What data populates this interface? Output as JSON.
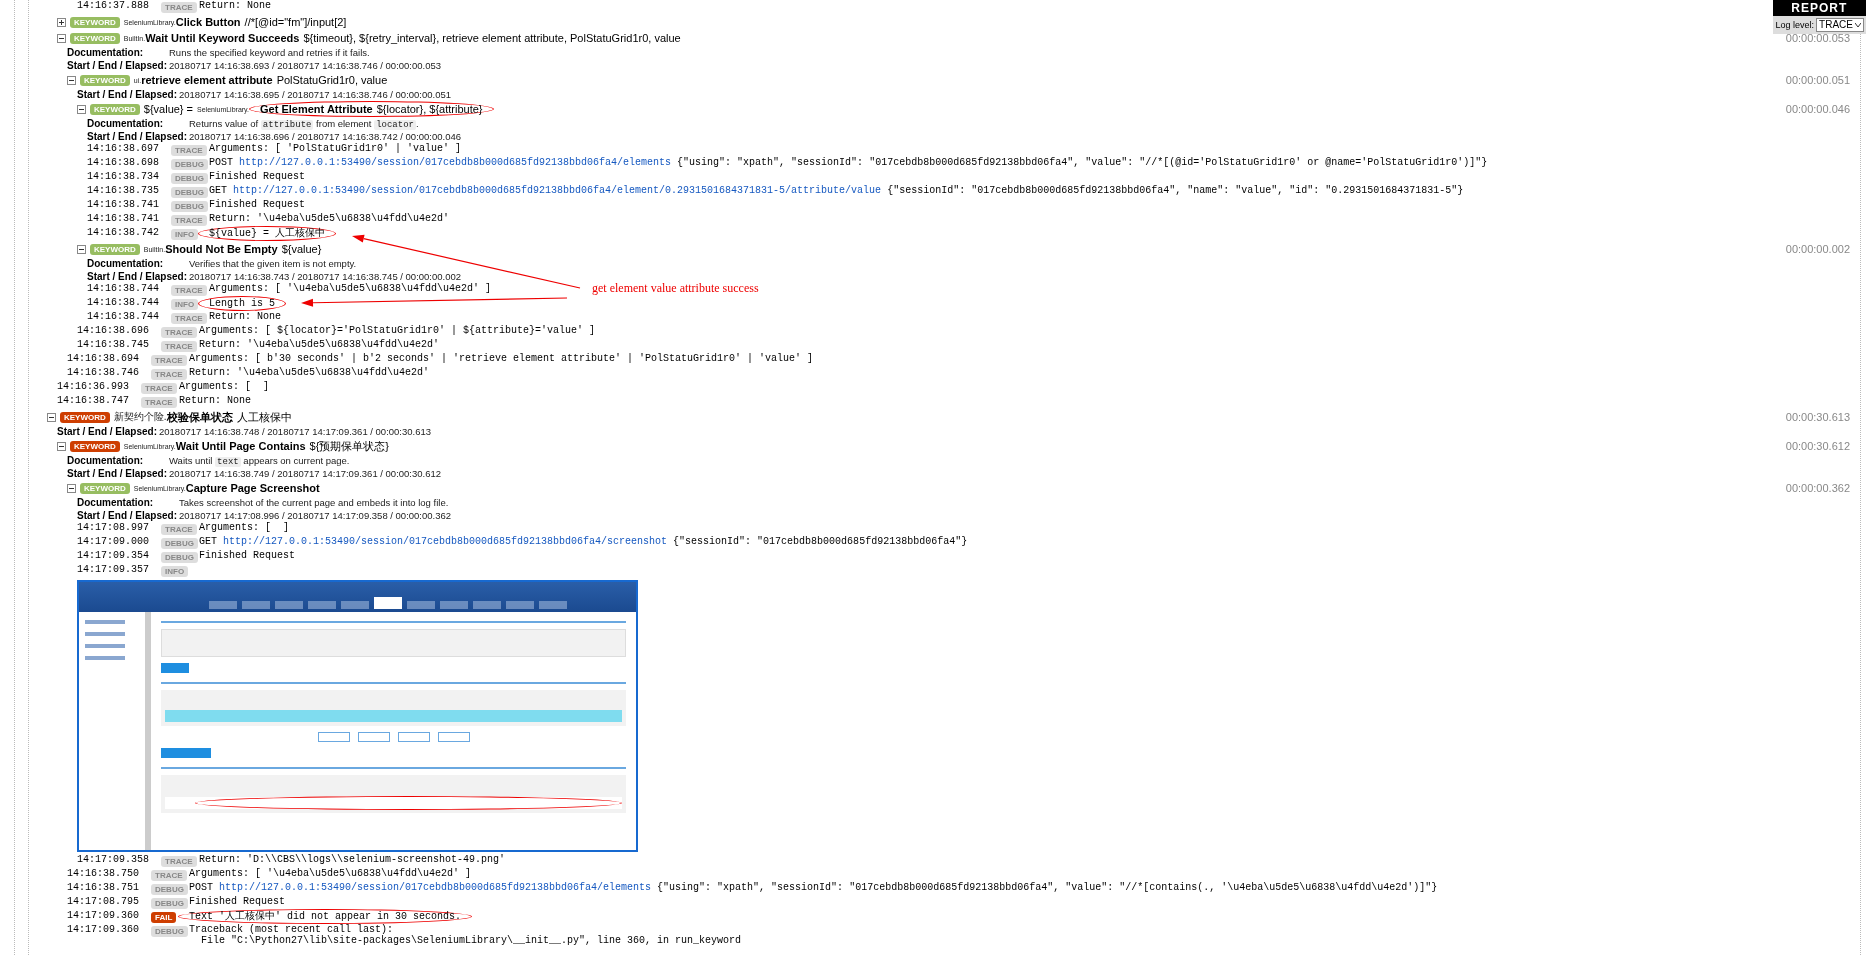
{
  "report_panel": {
    "title": "REPORT",
    "log_level_label": "Log level:",
    "log_level_value": "TRACE"
  },
  "log": [
    {
      "kind": "group",
      "children": [
        {
          "kind": "group",
          "children": [
            {
              "kind": "group",
              "children": [
                {
                  "kind": "message",
                  "time": "14:16:37.888",
                  "log_level": "TRACE",
                  "failed": false,
                  "circled": false,
                  "text": "Return: None"
                }
              ]
            }
          ]
        },
        {
          "kind": "keyword",
          "failed": false,
          "expanded": false,
          "circled": false,
          "badge": "KEYWORD",
          "library": "SeleniumLibrary.",
          "name": "Click Button",
          "args": "//*[@id=\"fm\"]/input[2]"
        },
        {
          "kind": "keyword",
          "failed": false,
          "expanded": true,
          "circled": false,
          "badge": "KEYWORD",
          "library": "BuiltIn.",
          "name": "Wait Until Keyword Succeeds",
          "args": "${timeout}, ${retry_interval}, retrieve element attribute, PolStatuGrid1r0, value",
          "elapsed": "00:00:00.053",
          "doc": {
            "label": "Documentation:",
            "parts": [
              {
                "kind": "text",
                "text": "Runs the specified keyword and retries if it fails."
              }
            ]
          },
          "times": {
            "label": "Start / End / Elapsed:",
            "value": "20180717 14:16:38.693 / 20180717 14:16:38.746 / 00:00:00.053"
          },
          "children": [
            {
              "kind": "keyword",
              "failed": false,
              "expanded": true,
              "circled": false,
              "badge": "KEYWORD",
              "library": "ui.",
              "name": "retrieve element attribute",
              "args": "PolStatuGrid1r0, value",
              "elapsed": "00:00:00.051",
              "times": {
                "label": "Start / End / Elapsed:",
                "value": "20180717 14:16:38.695 / 20180717 14:16:38.746 / 00:00:00.051"
              },
              "children": [
                {
                  "kind": "keyword",
                  "failed": false,
                  "expanded": true,
                  "circled": true,
                  "badge": "KEYWORD",
                  "assign": "${value} =",
                  "library": "SeleniumLibrary.",
                  "name": "Get Element Attribute",
                  "args": "${locator}, ${attribute}",
                  "elapsed": "00:00:00.046",
                  "doc": {
                    "label": "Documentation:",
                    "parts": [
                      {
                        "kind": "text",
                        "text": "Returns value of "
                      },
                      {
                        "kind": "code",
                        "text": "attribute"
                      },
                      {
                        "kind": "text",
                        "text": " from element "
                      },
                      {
                        "kind": "code",
                        "text": "locator"
                      },
                      {
                        "kind": "text",
                        "text": "."
                      }
                    ]
                  },
                  "times": {
                    "label": "Start / End / Elapsed:",
                    "value": "20180717 14:16:38.696 / 20180717 14:16:38.742 / 00:00:00.046"
                  },
                  "children": [
                    {
                      "kind": "message",
                      "time": "14:16:38.697",
                      "log_level": "TRACE",
                      "failed": false,
                      "circled": false,
                      "text": "Arguments: [ 'PolStatuGrid1r0' | 'value' ]"
                    },
                    {
                      "kind": "message",
                      "time": "14:16:38.698",
                      "log_level": "DEBUG",
                      "failed": false,
                      "circled": false,
                      "text": "POST ",
                      "link": "http://127.0.0.1:53490/session/017cebdb8b000d685fd92138bbd06fa4/elements",
                      "after": " {\"using\": \"xpath\", \"sessionId\": \"017cebdb8b000d685fd92138bbd06fa4\", \"value\": \"//*[(@id='PolStatuGrid1r0' or @name='PolStatuGrid1r0')]\"}"
                    },
                    {
                      "kind": "message",
                      "time": "14:16:38.734",
                      "log_level": "DEBUG",
                      "failed": false,
                      "circled": false,
                      "text": "Finished Request"
                    },
                    {
                      "kind": "message",
                      "time": "14:16:38.735",
                      "log_level": "DEBUG",
                      "failed": false,
                      "circled": false,
                      "text": "GET ",
                      "link": "http://127.0.0.1:53490/session/017cebdb8b000d685fd92138bbd06fa4/element/0.2931501684371831-5/attribute/value",
                      "after": " {\"sessionId\": \"017cebdb8b000d685fd92138bbd06fa4\", \"name\": \"value\", \"id\": \"0.2931501684371831-5\"}"
                    },
                    {
                      "kind": "message",
                      "time": "14:16:38.741",
                      "log_level": "DEBUG",
                      "failed": false,
                      "circled": false,
                      "text": "Finished Request"
                    },
                    {
                      "kind": "message",
                      "time": "14:16:38.741",
                      "log_level": "TRACE",
                      "failed": false,
                      "circled": false,
                      "text": "Return: '\\u4eba\\u5de5\\u6838\\u4fdd\\u4e2d'"
                    },
                    {
                      "kind": "message",
                      "time": "14:16:38.742",
                      "log_level": "INFO",
                      "failed": false,
                      "circled": true,
                      "text": "${value} = 人工核保中"
                    }
                  ]
                },
                {
                  "kind": "keyword",
                  "failed": false,
                  "expanded": true,
                  "circled": false,
                  "badge": "KEYWORD",
                  "library": "BuiltIn.",
                  "name": "Should Not Be Empty",
                  "args": "${value}",
                  "elapsed": "00:00:00.002",
                  "doc": {
                    "label": "Documentation:",
                    "parts": [
                      {
                        "kind": "text",
                        "text": "Verifies that the given item is not empty."
                      }
                    ]
                  },
                  "times": {
                    "label": "Start / End / Elapsed:",
                    "value": "20180717 14:16:38.743 / 20180717 14:16:38.745 / 00:00:00.002"
                  },
                  "children": [
                    {
                      "kind": "message",
                      "time": "14:16:38.744",
                      "log_level": "TRACE",
                      "failed": false,
                      "circled": false,
                      "text": "Arguments: [ '\\u4eba\\u5de5\\u6838\\u4fdd\\u4e2d' ]"
                    },
                    {
                      "kind": "message",
                      "time": "14:16:38.744",
                      "log_level": "INFO",
                      "failed": false,
                      "circled": true,
                      "text": "Length is 5"
                    },
                    {
                      "kind": "message",
                      "time": "14:16:38.744",
                      "log_level": "TRACE",
                      "failed": false,
                      "circled": false,
                      "text": "Return: None"
                    }
                  ]
                },
                {
                  "kind": "message",
                  "time": "14:16:38.696",
                  "log_level": "TRACE",
                  "failed": false,
                  "circled": false,
                  "text": "Arguments: [ ${locator}='PolStatuGrid1r0' | ${attribute}='value' ]"
                },
                {
                  "kind": "message",
                  "time": "14:16:38.745",
                  "log_level": "TRACE",
                  "failed": false,
                  "circled": false,
                  "text": "Return: '\\u4eba\\u5de5\\u6838\\u4fdd\\u4e2d'"
                }
              ]
            },
            {
              "kind": "message",
              "time": "14:16:38.694",
              "log_level": "TRACE",
              "failed": false,
              "circled": false,
              "text": "Arguments: [ b'30 seconds' | b'2 seconds' | 'retrieve element attribute' | 'PolStatuGrid1r0' | 'value' ]"
            },
            {
              "kind": "message",
              "time": "14:16:38.746",
              "log_level": "TRACE",
              "failed": false,
              "circled": false,
              "text": "Return: '\\u4eba\\u5de5\\u6838\\u4fdd\\u4e2d'"
            }
          ]
        },
        {
          "kind": "message",
          "time": "14:16:36.993",
          "log_level": "TRACE",
          "failed": false,
          "circled": false,
          "text": "Arguments: [  ]"
        },
        {
          "kind": "message",
          "time": "14:16:38.747",
          "log_level": "TRACE",
          "failed": false,
          "circled": false,
          "text": "Return: None"
        }
      ]
    },
    {
      "kind": "keyword",
      "failed": true,
      "expanded": true,
      "circled": false,
      "badge": "KEYWORD",
      "library": "新契约个险.",
      "name": "校验保单状态",
      "args": "人工核保中",
      "elapsed": "00:00:30.613",
      "times": {
        "label": "Start / End / Elapsed:",
        "value": "20180717 14:16:38.748 / 20180717 14:17:09.361 / 00:00:30.613"
      },
      "children": [
        {
          "kind": "keyword",
          "failed": true,
          "expanded": true,
          "circled": false,
          "badge": "KEYWORD",
          "library": "SeleniumLibrary.",
          "name": "Wait Until Page Contains",
          "args": "${预期保单状态}",
          "elapsed": "00:00:30.612",
          "doc": {
            "label": "Documentation:",
            "parts": [
              {
                "kind": "text",
                "text": "Waits until "
              },
              {
                "kind": "code",
                "text": "text"
              },
              {
                "kind": "text",
                "text": " appears on current page."
              }
            ]
          },
          "times": {
            "label": "Start / End / Elapsed:",
            "value": "20180717 14:16:38.749 / 20180717 14:17:09.361 / 00:00:30.612"
          },
          "children": [
            {
              "kind": "keyword",
              "failed": false,
              "expanded": true,
              "circled": false,
              "badge": "KEYWORD",
              "library": "SeleniumLibrary.",
              "name": "Capture Page Screenshot",
              "elapsed": "00:00:00.362",
              "doc": {
                "label": "Documentation:",
                "parts": [
                  {
                    "kind": "text",
                    "text": "Takes screenshot of the current page and embeds it into log file."
                  }
                ]
              },
              "times": {
                "label": "Start / End / Elapsed:",
                "value": "20180717 14:17:08.996 / 20180717 14:17:09.358 / 00:00:00.362"
              },
              "children": [
                {
                  "kind": "message",
                  "time": "14:17:08.997",
                  "log_level": "TRACE",
                  "failed": false,
                  "circled": false,
                  "text": "Arguments: [  ]"
                },
                {
                  "kind": "message",
                  "time": "14:17:09.000",
                  "log_level": "DEBUG",
                  "failed": false,
                  "circled": false,
                  "text": "GET ",
                  "link": "http://127.0.0.1:53490/session/017cebdb8b000d685fd92138bbd06fa4/screenshot",
                  "after": " {\"sessionId\": \"017cebdb8b000d685fd92138bbd06fa4\"}"
                },
                {
                  "kind": "message",
                  "time": "14:17:09.354",
                  "log_level": "DEBUG",
                  "failed": false,
                  "circled": false,
                  "text": "Finished Request"
                },
                {
                  "kind": "message",
                  "time": "14:17:09.357",
                  "log_level": "INFO",
                  "failed": false,
                  "screenshot": true
                },
                {
                  "kind": "message",
                  "time": "14:17:09.358",
                  "log_level": "TRACE",
                  "failed": false,
                  "circled": false,
                  "text": "Return: 'D:\\\\CBS\\\\logs\\\\selenium-screenshot-49.png'"
                }
              ]
            },
            {
              "kind": "message",
              "time": "14:16:38.750",
              "log_level": "TRACE",
              "failed": false,
              "circled": false,
              "text": "Arguments: [ '\\u4eba\\u5de5\\u6838\\u4fdd\\u4e2d' ]"
            },
            {
              "kind": "message",
              "time": "14:16:38.751",
              "log_level": "DEBUG",
              "failed": false,
              "circled": false,
              "text": "POST ",
              "link": "http://127.0.0.1:53490/session/017cebdb8b000d685fd92138bbd06fa4/elements",
              "after": " {\"using\": \"xpath\", \"sessionId\": \"017cebdb8b000d685fd92138bbd06fa4\", \"value\": \"//*[contains(., '\\u4eba\\u5de5\\u6838\\u4fdd\\u4e2d')]\"}"
            },
            {
              "kind": "message",
              "time": "14:17:08.795",
              "log_level": "DEBUG",
              "failed": false,
              "circled": false,
              "text": "Finished Request"
            },
            {
              "kind": "message",
              "time": "14:17:09.360",
              "log_level": "FAIL",
              "failed": true,
              "circled": true,
              "text": "Text '人工核保中' did not appear in 30 seconds."
            },
            {
              "kind": "message",
              "time": "14:17:09.360",
              "log_level": "DEBUG",
              "failed": false,
              "circled": false,
              "text": "Traceback (most recent call last):\n  File \"C:\\Python27\\lib\\site-packages\\SeleniumLibrary\\__init__.py\", line 360, in run_keyword"
            }
          ]
        }
      ]
    }
  ],
  "annotation": {
    "text": "get element value attribute success"
  }
}
